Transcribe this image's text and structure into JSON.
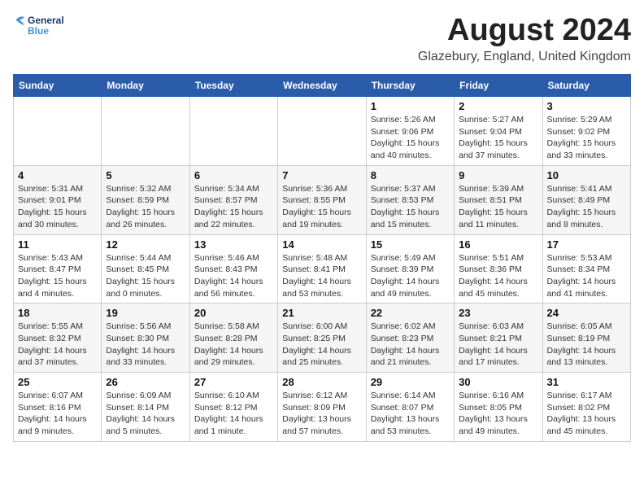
{
  "app": {
    "name": "GeneralBlue",
    "name_part1": "General",
    "name_part2": "Blue"
  },
  "header": {
    "month_year": "August 2024",
    "location": "Glazebury, England, United Kingdom"
  },
  "weekdays": [
    "Sunday",
    "Monday",
    "Tuesday",
    "Wednesday",
    "Thursday",
    "Friday",
    "Saturday"
  ],
  "weeks": [
    [
      {
        "day": "",
        "info": ""
      },
      {
        "day": "",
        "info": ""
      },
      {
        "day": "",
        "info": ""
      },
      {
        "day": "",
        "info": ""
      },
      {
        "day": "1",
        "info": "Sunrise: 5:26 AM\nSunset: 9:06 PM\nDaylight: 15 hours\nand 40 minutes."
      },
      {
        "day": "2",
        "info": "Sunrise: 5:27 AM\nSunset: 9:04 PM\nDaylight: 15 hours\nand 37 minutes."
      },
      {
        "day": "3",
        "info": "Sunrise: 5:29 AM\nSunset: 9:02 PM\nDaylight: 15 hours\nand 33 minutes."
      }
    ],
    [
      {
        "day": "4",
        "info": "Sunrise: 5:31 AM\nSunset: 9:01 PM\nDaylight: 15 hours\nand 30 minutes."
      },
      {
        "day": "5",
        "info": "Sunrise: 5:32 AM\nSunset: 8:59 PM\nDaylight: 15 hours\nand 26 minutes."
      },
      {
        "day": "6",
        "info": "Sunrise: 5:34 AM\nSunset: 8:57 PM\nDaylight: 15 hours\nand 22 minutes."
      },
      {
        "day": "7",
        "info": "Sunrise: 5:36 AM\nSunset: 8:55 PM\nDaylight: 15 hours\nand 19 minutes."
      },
      {
        "day": "8",
        "info": "Sunrise: 5:37 AM\nSunset: 8:53 PM\nDaylight: 15 hours\nand 15 minutes."
      },
      {
        "day": "9",
        "info": "Sunrise: 5:39 AM\nSunset: 8:51 PM\nDaylight: 15 hours\nand 11 minutes."
      },
      {
        "day": "10",
        "info": "Sunrise: 5:41 AM\nSunset: 8:49 PM\nDaylight: 15 hours\nand 8 minutes."
      }
    ],
    [
      {
        "day": "11",
        "info": "Sunrise: 5:43 AM\nSunset: 8:47 PM\nDaylight: 15 hours\nand 4 minutes."
      },
      {
        "day": "12",
        "info": "Sunrise: 5:44 AM\nSunset: 8:45 PM\nDaylight: 15 hours\nand 0 minutes."
      },
      {
        "day": "13",
        "info": "Sunrise: 5:46 AM\nSunset: 8:43 PM\nDaylight: 14 hours\nand 56 minutes."
      },
      {
        "day": "14",
        "info": "Sunrise: 5:48 AM\nSunset: 8:41 PM\nDaylight: 14 hours\nand 53 minutes."
      },
      {
        "day": "15",
        "info": "Sunrise: 5:49 AM\nSunset: 8:39 PM\nDaylight: 14 hours\nand 49 minutes."
      },
      {
        "day": "16",
        "info": "Sunrise: 5:51 AM\nSunset: 8:36 PM\nDaylight: 14 hours\nand 45 minutes."
      },
      {
        "day": "17",
        "info": "Sunrise: 5:53 AM\nSunset: 8:34 PM\nDaylight: 14 hours\nand 41 minutes."
      }
    ],
    [
      {
        "day": "18",
        "info": "Sunrise: 5:55 AM\nSunset: 8:32 PM\nDaylight: 14 hours\nand 37 minutes."
      },
      {
        "day": "19",
        "info": "Sunrise: 5:56 AM\nSunset: 8:30 PM\nDaylight: 14 hours\nand 33 minutes."
      },
      {
        "day": "20",
        "info": "Sunrise: 5:58 AM\nSunset: 8:28 PM\nDaylight: 14 hours\nand 29 minutes."
      },
      {
        "day": "21",
        "info": "Sunrise: 6:00 AM\nSunset: 8:25 PM\nDaylight: 14 hours\nand 25 minutes."
      },
      {
        "day": "22",
        "info": "Sunrise: 6:02 AM\nSunset: 8:23 PM\nDaylight: 14 hours\nand 21 minutes."
      },
      {
        "day": "23",
        "info": "Sunrise: 6:03 AM\nSunset: 8:21 PM\nDaylight: 14 hours\nand 17 minutes."
      },
      {
        "day": "24",
        "info": "Sunrise: 6:05 AM\nSunset: 8:19 PM\nDaylight: 14 hours\nand 13 minutes."
      }
    ],
    [
      {
        "day": "25",
        "info": "Sunrise: 6:07 AM\nSunset: 8:16 PM\nDaylight: 14 hours\nand 9 minutes."
      },
      {
        "day": "26",
        "info": "Sunrise: 6:09 AM\nSunset: 8:14 PM\nDaylight: 14 hours\nand 5 minutes."
      },
      {
        "day": "27",
        "info": "Sunrise: 6:10 AM\nSunset: 8:12 PM\nDaylight: 14 hours\nand 1 minute."
      },
      {
        "day": "28",
        "info": "Sunrise: 6:12 AM\nSunset: 8:09 PM\nDaylight: 13 hours\nand 57 minutes."
      },
      {
        "day": "29",
        "info": "Sunrise: 6:14 AM\nSunset: 8:07 PM\nDaylight: 13 hours\nand 53 minutes."
      },
      {
        "day": "30",
        "info": "Sunrise: 6:16 AM\nSunset: 8:05 PM\nDaylight: 13 hours\nand 49 minutes."
      },
      {
        "day": "31",
        "info": "Sunrise: 6:17 AM\nSunset: 8:02 PM\nDaylight: 13 hours\nand 45 minutes."
      }
    ]
  ]
}
